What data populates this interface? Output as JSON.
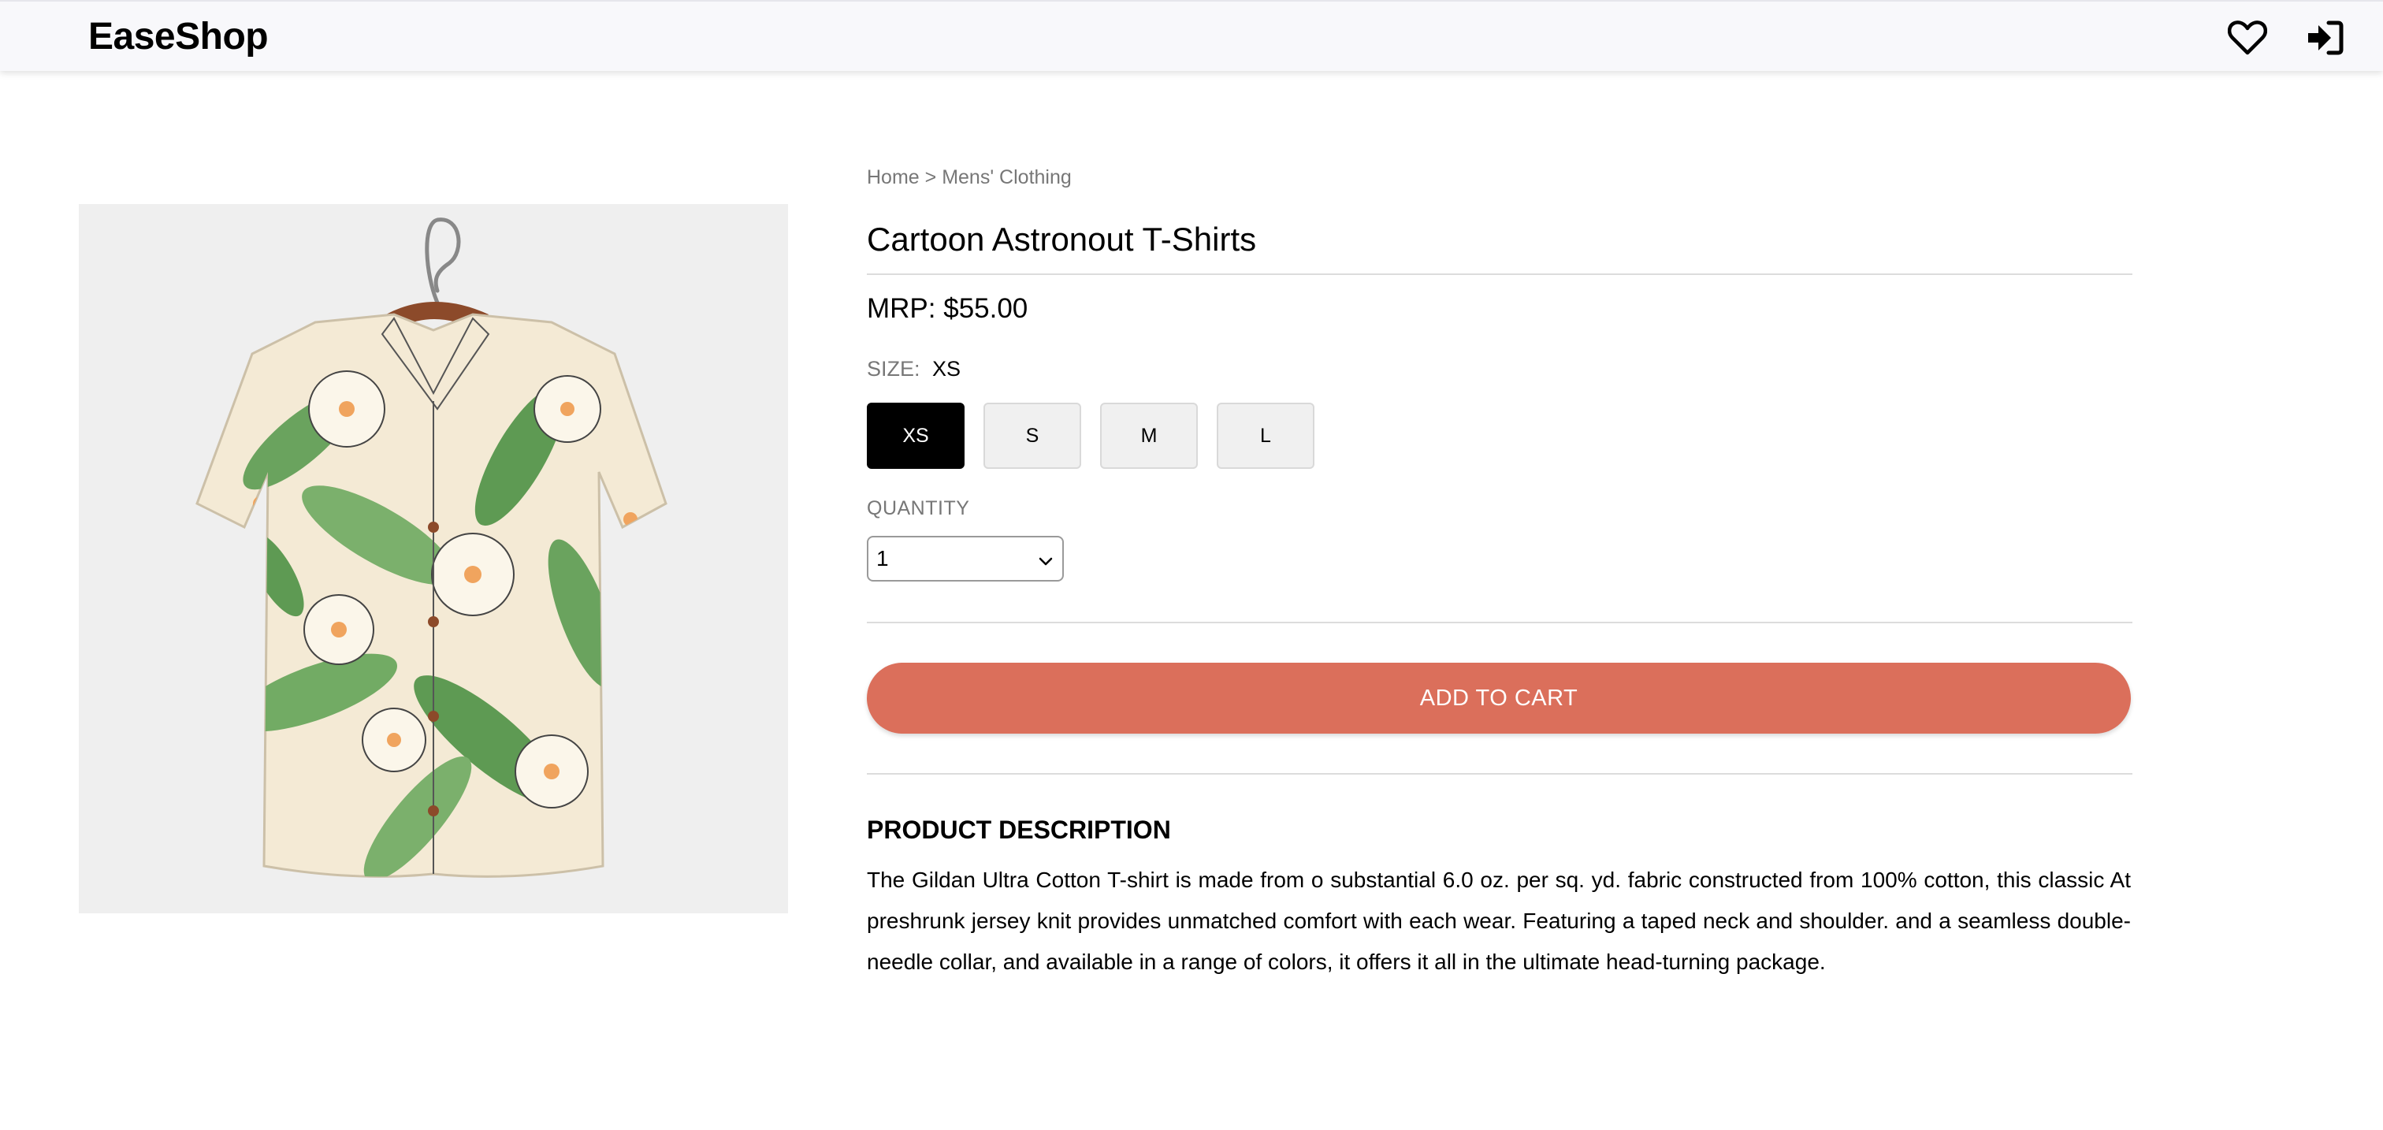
{
  "header": {
    "brand": "EaseShop",
    "icons": [
      "heart-icon",
      "login-icon"
    ]
  },
  "product": {
    "breadcrumb": {
      "home": "Home",
      "separator": ">",
      "category": "Mens' Clothing"
    },
    "title": "Cartoon Astronout T-Shirts",
    "price": "MRP: $55.00",
    "size": {
      "label": "SIZE:",
      "selected": "XS",
      "options": [
        "XS",
        "S",
        "M",
        "L"
      ]
    },
    "quantity": {
      "label": "QUANTITY",
      "value": "1"
    },
    "add_to_cart_label": "ADD TO CART",
    "description": {
      "heading": "PRODUCT DESCRIPTION",
      "text": "The Gildan Ultra Cotton T-shirt is made from o substantial 6.0 oz. per sq. yd. fabric constructed from 100% cotton, this classic At preshrunk jersey knit provides unmatched comfort with each wear. Featuring a taped neck and shoulder. and a seamless double-needle collar, and available in a range of colors, it offers it all in the ultimate head-turning package."
    }
  },
  "colors": {
    "accent": "#db6f5b",
    "selected_size_bg": "#000000",
    "nav_bg": "#f8f8fb",
    "image_bg": "#efefef"
  }
}
